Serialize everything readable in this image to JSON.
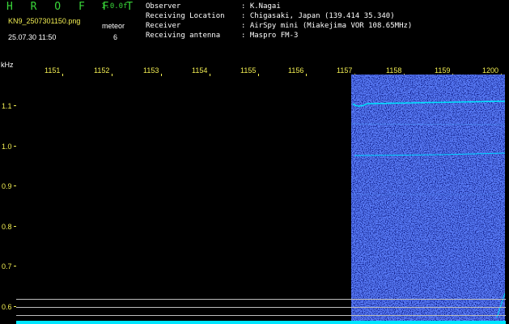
{
  "header": {
    "logo": "H R O F F T",
    "version": "1.0.0f",
    "filename": "KN9_2507301150.png",
    "mode_label": "meteor",
    "datetime": "25.07.30 11:50",
    "count": "6"
  },
  "info": [
    {
      "label": "Observer",
      "value": ": K.Nagai"
    },
    {
      "label": "Receiving Location",
      "value": ": Chigasaki, Japan (139.414 35.340)"
    },
    {
      "label": "Receiver",
      "value": ": AirSpy mini (Miakejima VOR 108.65MHz)"
    },
    {
      "label": "Receiving antenna",
      "value": ": Maspro FM-3"
    }
  ],
  "axis": {
    "y_unit": "kHz",
    "x_ticks": [
      "1151",
      "1152",
      "1153",
      "1154",
      "1155",
      "1156",
      "1157",
      "1158",
      "1159",
      "1200"
    ],
    "y_ticks": [
      "1.1",
      "1.0",
      "0.9",
      "0.8",
      "0.7",
      "0.6"
    ]
  },
  "colors": {
    "logo": "#39d639",
    "ticks": "#f2ee52",
    "signal": "#00e5ff",
    "background": "#000000",
    "noise": "#1a3cff"
  }
}
